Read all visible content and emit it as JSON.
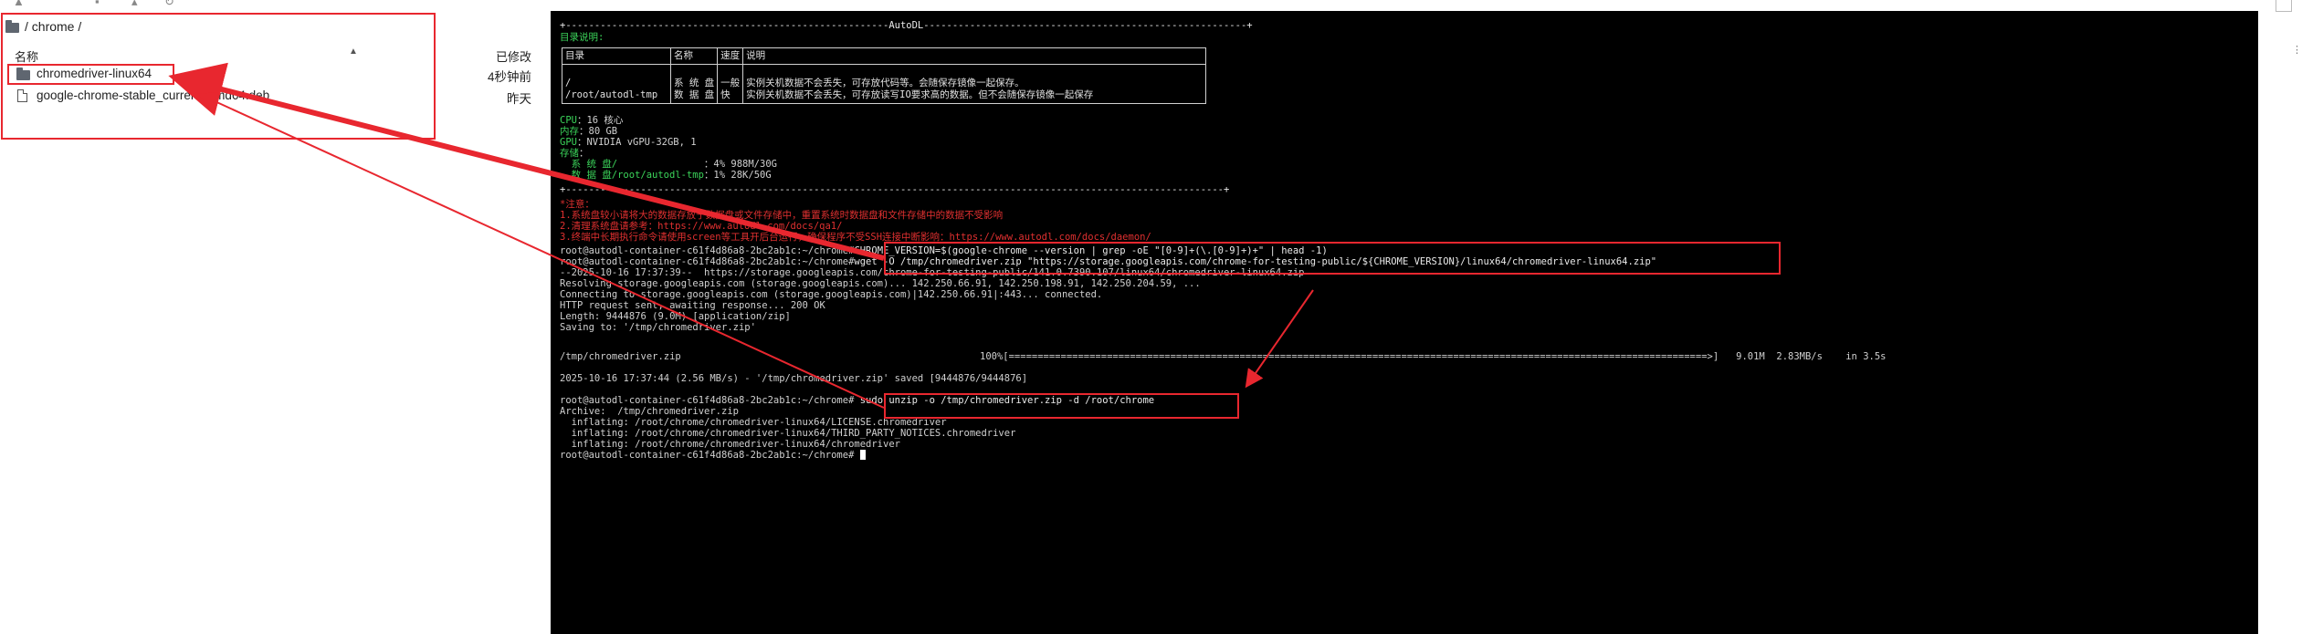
{
  "file_panel": {
    "path": "/ chrome /",
    "columns": {
      "name": "名称",
      "modified": "已修改"
    },
    "files": [
      {
        "name": "chromedriver-linux64",
        "type": "folder",
        "modified": "4秒钟前"
      },
      {
        "name": "google-chrome-stable_current_amd64.deb",
        "type": "file",
        "modified": "昨天"
      }
    ]
  },
  "terminal": {
    "banner": "+--------------------------------------------------------AutoDL--------------------------------------------------------+",
    "dir_heading": "目录说明:",
    "table": {
      "headers": [
        "目录",
        "名称",
        "速度",
        "说明"
      ],
      "row": {
        "dirs": "/\n/root/autodl-tmp",
        "names": "系 统 盘\n数 据 盘",
        "speeds": "一般\n快",
        "notes": "实例关机数据不会丢失，可存放代码等。会随保存镜像一起保存。\n实例关机数据不会丢失，可存放读写IO要求高的数据。但不会随保存镜像一起保存"
      }
    },
    "sysinfo": [
      {
        "label": "CPU",
        "value": "：16 核心"
      },
      {
        "label": "内存",
        "value": "：80 GB"
      },
      {
        "label": "GPU",
        "value": "：NVIDIA vGPU-32GB, 1"
      },
      {
        "label": "存储",
        "value": "："
      },
      {
        "label": "  系 统 盘/",
        "value": "               ：4% 988M/30G"
      },
      {
        "label": "  数 据 盘/root/autodl-tmp",
        "value": "：1% 28K/50G"
      }
    ],
    "separator": "+------------------------------------------------------------------------------------------------------------------+",
    "notice_title": "*注意：",
    "notices": [
      "1.系统盘较小请将大的数据存放于数据盘或文件存储中，重置系统时数据盘和文件存储中的数据不受影响",
      "2.清理系统盘请参考：https://www.autodl.com/docs/qa1/",
      "3.终端中长期执行命令请使用screen等工具开后台运行，确保程序不受SSH连接中断影响：https://www.autodl.com/docs/daemon/"
    ],
    "prompt": "root@autodl-container-c61f4d86a8-2bc2ab1c:~/chrome#",
    "cmd1": "CHROME_VERSION=$(google-chrome --version | grep -oE \"[0-9]+(\\.[0-9]+)+\" | head -1)",
    "cmd2": "wget -O /tmp/chromedriver.zip \"https://storage.googleapis.com/chrome-for-testing-public/${CHROME_VERSION}/linux64/chromedriver-linux64.zip\"",
    "wget_lines": [
      "--2025-10-16 17:37:39--  https://storage.googleapis.com/chrome-for-testing-public/141.0.7390.107/linux64/chromedriver-linux64.zip",
      "Resolving storage.googleapis.com (storage.googleapis.com)... 142.250.66.91, 142.250.198.91, 142.250.204.59, ...",
      "Connecting to storage.googleapis.com (storage.googleapis.com)|142.250.66.91|:443... connected.",
      "HTTP request sent, awaiting response... 200 OK",
      "Length: 9444876 (9.0M) [application/zip]",
      "Saving to: '/tmp/chromedriver.zip'"
    ],
    "progress_file": "/tmp/chromedriver.zip",
    "progress_bar": "100%[=========================================================================================================================>]   9.01M  2.83MB/s    in 3.5s",
    "saved_line": "2025-10-16 17:37:44 (2.56 MB/s) - '/tmp/chromedriver.zip' saved [9444876/9444876]",
    "cmd3": "sudo unzip -o /tmp/chromedriver.zip -d /root/chrome",
    "unzip_lines": [
      "Archive:  /tmp/chromedriver.zip",
      "  inflating: /root/chrome/chromedriver-linux64/LICENSE.chromedriver",
      "  inflating: /root/chrome/chromedriver-linux64/THIRD_PARTY_NOTICES.chromedriver",
      "  inflating: /root/chrome/chromedriver-linux64/chromedriver"
    ]
  },
  "colors": {
    "annotation_red": "#e8272f",
    "terminal_bg": "#000000",
    "terminal_green": "#3bd45a",
    "terminal_red": "#e03030"
  }
}
